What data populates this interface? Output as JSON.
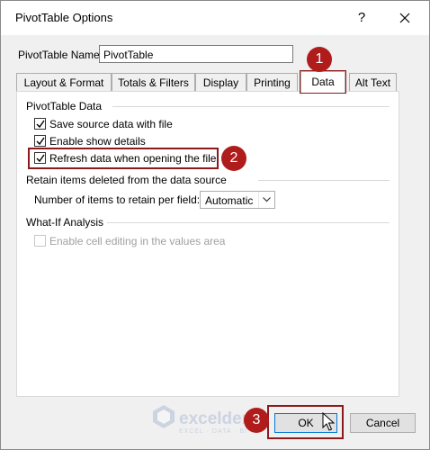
{
  "window": {
    "title": "PivotTable Options",
    "help_label": "?"
  },
  "name_field": {
    "label": "PivotTable Name:",
    "value": "PivotTable"
  },
  "tabs": [
    {
      "label": "Layout & Format"
    },
    {
      "label": "Totals & Filters"
    },
    {
      "label": "Display"
    },
    {
      "label": "Printing"
    },
    {
      "label": "Data",
      "active": true
    },
    {
      "label": "Alt Text"
    }
  ],
  "sections": {
    "pivot_data": {
      "title": "PivotTable Data",
      "save_source": {
        "label": "Save source data with file",
        "checked": true
      },
      "enable_details": {
        "label": "Enable show details",
        "checked": true
      },
      "refresh_on_open": {
        "label": "Refresh data when opening the file",
        "checked": true
      }
    },
    "retain": {
      "title": "Retain items deleted from the data source",
      "items_label": "Number of items to retain per field:",
      "items_value": "Automatic"
    },
    "what_if": {
      "title": "What-If Analysis",
      "cell_editing": {
        "label": "Enable cell editing in the values area",
        "checked": false,
        "enabled": false
      }
    }
  },
  "buttons": {
    "ok": "OK",
    "cancel": "Cancel"
  },
  "callouts": {
    "step1": "1",
    "step2": "2",
    "step3": "3"
  },
  "watermark": {
    "name": "exceldemy",
    "tagline": "EXCEL · DATA · BI"
  },
  "colors": {
    "highlight": "#8b1a1a",
    "badge": "#b01c1c",
    "default_button_border": "#0078d7"
  }
}
